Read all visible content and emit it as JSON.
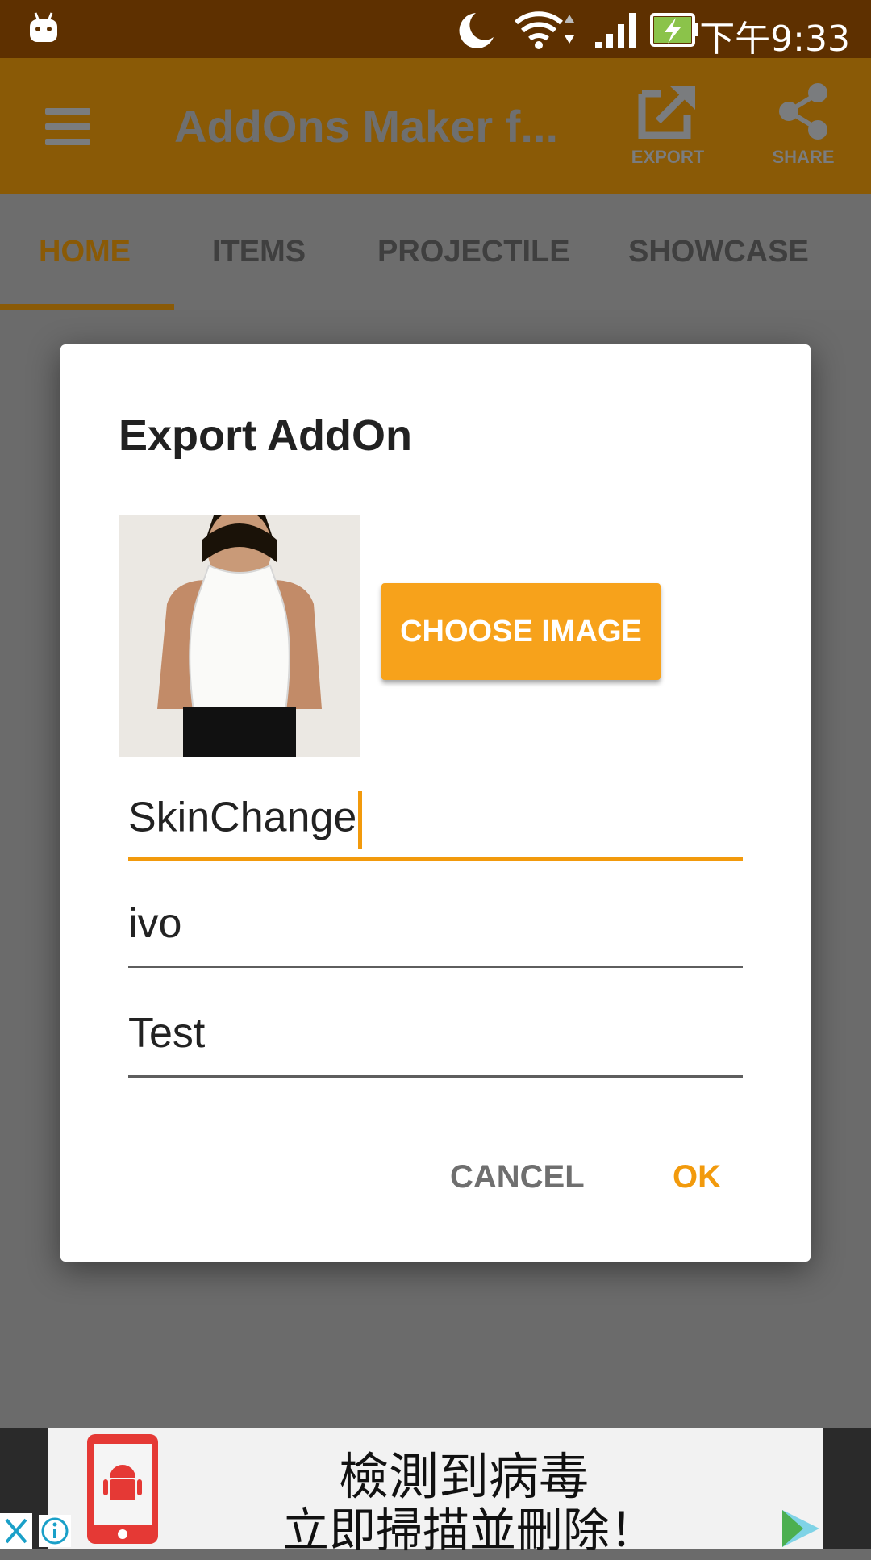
{
  "status_bar": {
    "time": "下午9:33",
    "icons": [
      "android-notification-icon",
      "moon-icon",
      "wifi-icon",
      "signal-icon",
      "battery-charging-icon"
    ]
  },
  "toolbar": {
    "title": "AddOns Maker f...",
    "export_label": "EXPORT",
    "share_label": "SHARE",
    "brand_color": "#F29A0C"
  },
  "tabs": [
    {
      "label": "HOME",
      "active": true
    },
    {
      "label": "ITEMS",
      "active": false
    },
    {
      "label": "PROJECTILE",
      "active": false
    },
    {
      "label": "SHOWCASE",
      "active": false
    }
  ],
  "dialog": {
    "title": "Export AddOn",
    "choose_image_label": "CHOOSE IMAGE",
    "fields": [
      {
        "value": "SkinChange",
        "focused": true
      },
      {
        "value": "ivo",
        "focused": false
      },
      {
        "value": "Test",
        "focused": false
      }
    ],
    "cancel_label": "CANCEL",
    "ok_label": "OK"
  },
  "ad": {
    "line1": "檢測到病毒",
    "line2": "立即掃描並刪除！"
  }
}
